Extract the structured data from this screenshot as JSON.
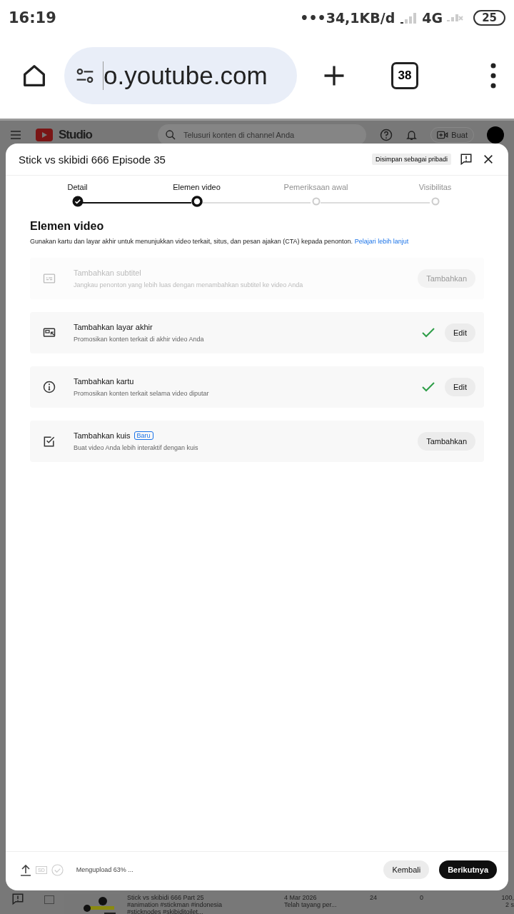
{
  "status_bar": {
    "time": "16:19",
    "speed": "•••34,1KB/d",
    "network": "4G",
    "battery": "25"
  },
  "browser": {
    "url": "o.youtube.com",
    "tab_count": "38"
  },
  "studio_header": {
    "logo": "Studio",
    "search": {
      "placeholder": "Telusuri konten di channel Anda"
    },
    "create_label": "Buat"
  },
  "dialog": {
    "title": "Stick vs skibidi 666 Episode 35",
    "saved_badge": "Disimpan sebagai pribadi",
    "steps": [
      {
        "label": "Detail",
        "completed": true,
        "selected": false
      },
      {
        "label": "Elemen video",
        "completed": false,
        "selected": true
      },
      {
        "label": "Pemeriksaan awal",
        "completed": false,
        "selected": false
      },
      {
        "label": "Visibilitas",
        "completed": false,
        "selected": false
      }
    ],
    "heading": "Elemen video",
    "description": "Gunakan kartu dan layar akhir untuk menunjukkan video terkait, situs, dan pesan ajakan (CTA) kepada penonton.",
    "link": "Pelajari lebih lanjut",
    "items": [
      {
        "kind": "subtitles",
        "title": "Tambahkan subtitel",
        "subtitle": "Jangkau penonton yang lebih luas dengan menambahkan subtitel ke video Anda",
        "button": "Tambahkan",
        "disabled": true,
        "done": false
      },
      {
        "kind": "endscreen",
        "title": "Tambahkan layar akhir",
        "subtitle": "Promosikan konten terkait di akhir video Anda",
        "button": "Edit",
        "disabled": false,
        "done": true
      },
      {
        "kind": "cards",
        "title": "Tambahkan kartu",
        "subtitle": "Promosikan konten terkait selama video diputar",
        "button": "Edit",
        "disabled": false,
        "done": true
      },
      {
        "kind": "quiz",
        "title": "Tambahkan kuis",
        "badge": "Baru",
        "subtitle": "Buat video Anda lebih interaktif dengan kuis",
        "button": "Tambahkan",
        "disabled": false,
        "done": false
      }
    ],
    "footer": {
      "sd_label": "SD",
      "progress": "Mengupload 63% ...",
      "back": "Kembali",
      "next": "Berikutnya"
    }
  },
  "background_row": {
    "checked": false,
    "title": "Stick vs skibidi 666 Part 25",
    "tags_1": "#animation #stickman #indonesia",
    "tags_2": "#sticknodes #skibiditoilet...",
    "date": "4 Mar 2026",
    "status": "Telah tayang per...",
    "views": "24",
    "comments": "0",
    "column_6": "100,",
    "column_6_sub": "2 s"
  }
}
